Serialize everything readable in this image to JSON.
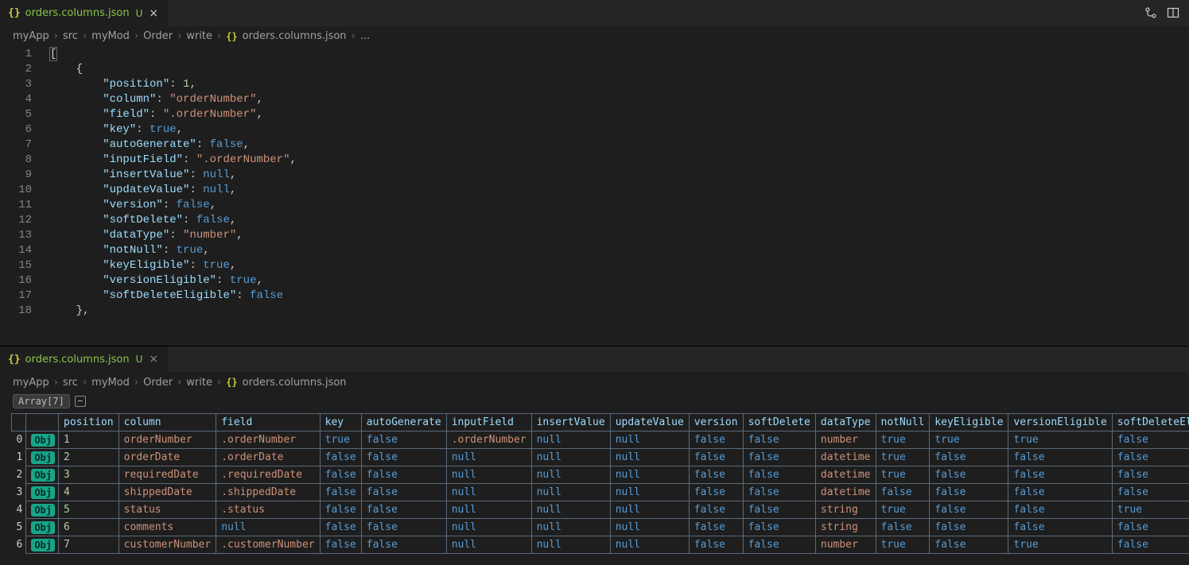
{
  "tab": {
    "icon": "{}",
    "filename": "orders.columns.json",
    "modified_marker": "U",
    "close_glyph": "×"
  },
  "breadcrumbs_top": [
    "myApp",
    "src",
    "myMod",
    "Order",
    "write"
  ],
  "breadcrumbs_file": "orders.columns.json",
  "breadcrumbs_trailing": "...",
  "breadcrumbs_bottom": [
    "myApp",
    "src",
    "myMod",
    "Order",
    "write"
  ],
  "breadcrumbs_bottom_file": "orders.columns.json",
  "code_lines": [
    {
      "n": 1,
      "tokens": [
        [
          "punc",
          "["
        ]
      ],
      "hl_first": true
    },
    {
      "n": 2,
      "tokens": [
        [
          "punc",
          "    {"
        ]
      ]
    },
    {
      "n": 3,
      "tokens": [
        [
          "punc",
          "        "
        ],
        [
          "key",
          "\"position\""
        ],
        [
          "punc",
          ": "
        ],
        [
          "num",
          "1"
        ],
        [
          "punc",
          ","
        ]
      ]
    },
    {
      "n": 4,
      "tokens": [
        [
          "punc",
          "        "
        ],
        [
          "key",
          "\"column\""
        ],
        [
          "punc",
          ": "
        ],
        [
          "str",
          "\"orderNumber\""
        ],
        [
          "punc",
          ","
        ]
      ]
    },
    {
      "n": 5,
      "tokens": [
        [
          "punc",
          "        "
        ],
        [
          "key",
          "\"field\""
        ],
        [
          "punc",
          ": "
        ],
        [
          "str",
          "\".orderNumber\""
        ],
        [
          "punc",
          ","
        ]
      ]
    },
    {
      "n": 6,
      "tokens": [
        [
          "punc",
          "        "
        ],
        [
          "key",
          "\"key\""
        ],
        [
          "punc",
          ": "
        ],
        [
          "kw",
          "true"
        ],
        [
          "punc",
          ","
        ]
      ]
    },
    {
      "n": 7,
      "tokens": [
        [
          "punc",
          "        "
        ],
        [
          "key",
          "\"autoGenerate\""
        ],
        [
          "punc",
          ": "
        ],
        [
          "kw",
          "false"
        ],
        [
          "punc",
          ","
        ]
      ]
    },
    {
      "n": 8,
      "tokens": [
        [
          "punc",
          "        "
        ],
        [
          "key",
          "\"inputField\""
        ],
        [
          "punc",
          ": "
        ],
        [
          "str",
          "\".orderNumber\""
        ],
        [
          "punc",
          ","
        ]
      ]
    },
    {
      "n": 9,
      "tokens": [
        [
          "punc",
          "        "
        ],
        [
          "key",
          "\"insertValue\""
        ],
        [
          "punc",
          ": "
        ],
        [
          "kw",
          "null"
        ],
        [
          "punc",
          ","
        ]
      ]
    },
    {
      "n": 10,
      "tokens": [
        [
          "punc",
          "        "
        ],
        [
          "key",
          "\"updateValue\""
        ],
        [
          "punc",
          ": "
        ],
        [
          "kw",
          "null"
        ],
        [
          "punc",
          ","
        ]
      ]
    },
    {
      "n": 11,
      "tokens": [
        [
          "punc",
          "        "
        ],
        [
          "key",
          "\"version\""
        ],
        [
          "punc",
          ": "
        ],
        [
          "kw",
          "false"
        ],
        [
          "punc",
          ","
        ]
      ]
    },
    {
      "n": 12,
      "tokens": [
        [
          "punc",
          "        "
        ],
        [
          "key",
          "\"softDelete\""
        ],
        [
          "punc",
          ": "
        ],
        [
          "kw",
          "false"
        ],
        [
          "punc",
          ","
        ]
      ]
    },
    {
      "n": 13,
      "tokens": [
        [
          "punc",
          "        "
        ],
        [
          "key",
          "\"dataType\""
        ],
        [
          "punc",
          ": "
        ],
        [
          "str",
          "\"number\""
        ],
        [
          "punc",
          ","
        ]
      ]
    },
    {
      "n": 14,
      "tokens": [
        [
          "punc",
          "        "
        ],
        [
          "key",
          "\"notNull\""
        ],
        [
          "punc",
          ": "
        ],
        [
          "kw",
          "true"
        ],
        [
          "punc",
          ","
        ]
      ]
    },
    {
      "n": 15,
      "tokens": [
        [
          "punc",
          "        "
        ],
        [
          "key",
          "\"keyEligible\""
        ],
        [
          "punc",
          ": "
        ],
        [
          "kw",
          "true"
        ],
        [
          "punc",
          ","
        ]
      ]
    },
    {
      "n": 16,
      "tokens": [
        [
          "punc",
          "        "
        ],
        [
          "key",
          "\"versionEligible\""
        ],
        [
          "punc",
          ": "
        ],
        [
          "kw",
          "true"
        ],
        [
          "punc",
          ","
        ]
      ]
    },
    {
      "n": 17,
      "tokens": [
        [
          "punc",
          "        "
        ],
        [
          "key",
          "\"softDeleteEligible\""
        ],
        [
          "punc",
          ": "
        ],
        [
          "kw",
          "false"
        ]
      ]
    },
    {
      "n": 18,
      "tokens": [
        [
          "punc",
          "    },"
        ]
      ]
    }
  ],
  "array_label": "Array[7]",
  "collapse_glyph": "−",
  "obj_label": "Obj",
  "columns": [
    "position",
    "column",
    "field",
    "key",
    "autoGenerate",
    "inputField",
    "insertValue",
    "updateValue",
    "version",
    "softDelete",
    "dataType",
    "notNull",
    "keyEligible",
    "versionEligible",
    "softDeleteEligible"
  ],
  "rows": [
    {
      "idx": 0,
      "position": 1,
      "column": "orderNumber",
      "field": ".orderNumber",
      "key": true,
      "autoGenerate": false,
      "inputField": ".orderNumber",
      "insertValue": null,
      "updateValue": null,
      "version": false,
      "softDelete": false,
      "dataType": "number",
      "notNull": true,
      "keyEligible": true,
      "versionEligible": true,
      "softDeleteEligible": false
    },
    {
      "idx": 1,
      "position": 2,
      "column": "orderDate",
      "field": ".orderDate",
      "key": false,
      "autoGenerate": false,
      "inputField": null,
      "insertValue": null,
      "updateValue": null,
      "version": false,
      "softDelete": false,
      "dataType": "datetime",
      "notNull": true,
      "keyEligible": false,
      "versionEligible": false,
      "softDeleteEligible": false
    },
    {
      "idx": 2,
      "position": 3,
      "column": "requiredDate",
      "field": ".requiredDate",
      "key": false,
      "autoGenerate": false,
      "inputField": null,
      "insertValue": null,
      "updateValue": null,
      "version": false,
      "softDelete": false,
      "dataType": "datetime",
      "notNull": true,
      "keyEligible": false,
      "versionEligible": false,
      "softDeleteEligible": false
    },
    {
      "idx": 3,
      "position": 4,
      "column": "shippedDate",
      "field": ".shippedDate",
      "key": false,
      "autoGenerate": false,
      "inputField": null,
      "insertValue": null,
      "updateValue": null,
      "version": false,
      "softDelete": false,
      "dataType": "datetime",
      "notNull": false,
      "keyEligible": false,
      "versionEligible": false,
      "softDeleteEligible": false
    },
    {
      "idx": 4,
      "position": 5,
      "column": "status",
      "field": ".status",
      "key": false,
      "autoGenerate": false,
      "inputField": null,
      "insertValue": null,
      "updateValue": null,
      "version": false,
      "softDelete": false,
      "dataType": "string",
      "notNull": true,
      "keyEligible": false,
      "versionEligible": false,
      "softDeleteEligible": true
    },
    {
      "idx": 5,
      "position": 6,
      "column": "comments",
      "field": null,
      "key": false,
      "autoGenerate": false,
      "inputField": null,
      "insertValue": null,
      "updateValue": null,
      "version": false,
      "softDelete": false,
      "dataType": "string",
      "notNull": false,
      "keyEligible": false,
      "versionEligible": false,
      "softDeleteEligible": false
    },
    {
      "idx": 6,
      "position": 7,
      "column": "customerNumber",
      "field": ".customerNumber",
      "key": false,
      "autoGenerate": false,
      "inputField": null,
      "insertValue": null,
      "updateValue": null,
      "version": false,
      "softDelete": false,
      "dataType": "number",
      "notNull": true,
      "keyEligible": false,
      "versionEligible": true,
      "softDeleteEligible": false
    }
  ]
}
